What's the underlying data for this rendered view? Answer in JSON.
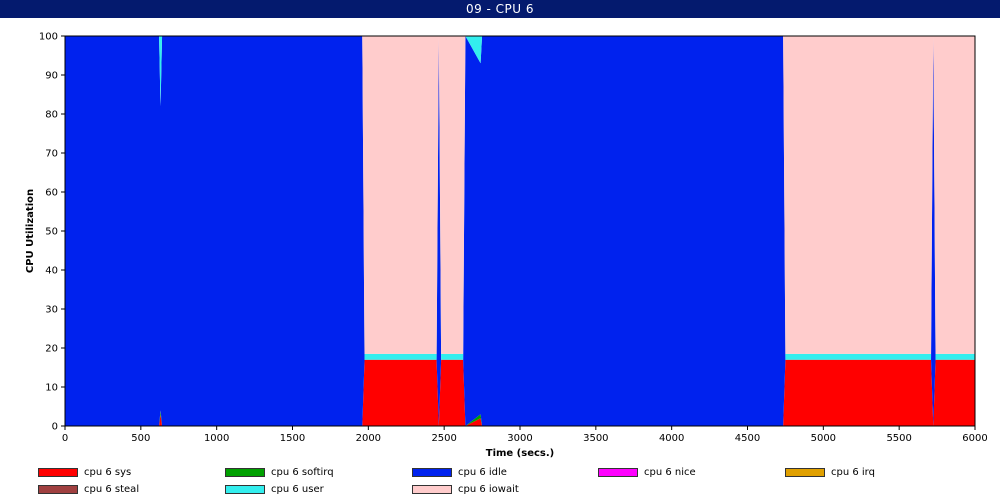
{
  "window": {
    "title": "09 - CPU 6"
  },
  "chart_data": {
    "type": "area",
    "stacked": true,
    "title": "09 - CPU 6",
    "xlabel": "Time (secs.)",
    "ylabel": "CPU Utilization",
    "xlim": [
      0,
      6000
    ],
    "ylim": [
      0,
      100
    ],
    "x_ticks": [
      0,
      500,
      1000,
      1500,
      2000,
      2500,
      3000,
      3500,
      4000,
      4500,
      5000,
      5500,
      6000
    ],
    "y_ticks": [
      0,
      10,
      20,
      30,
      40,
      50,
      60,
      70,
      80,
      90,
      100
    ],
    "grid": false,
    "legend_position": "bottom",
    "x": [
      0,
      620,
      630,
      640,
      650,
      1960,
      1975,
      1990,
      2450,
      2465,
      2480,
      2500,
      2625,
      2640,
      2740,
      2750,
      2760,
      4735,
      4750,
      4765,
      5710,
      5725,
      5740,
      5755,
      6000
    ],
    "series": [
      {
        "name": "cpu 6 sys",
        "color": "#ff0000",
        "values": [
          0,
          0,
          3,
          0,
          0,
          0,
          17,
          17,
          17,
          0,
          17,
          17,
          17,
          0,
          2,
          0,
          0,
          0,
          17,
          17,
          17,
          0,
          17,
          17,
          17
        ]
      },
      {
        "name": "cpu 6 softirq",
        "color": "#00a000",
        "values": [
          0,
          0,
          1,
          0,
          0,
          0,
          0,
          0,
          0,
          0,
          0,
          0,
          0,
          0,
          1,
          0,
          0,
          0,
          0,
          0,
          0,
          0,
          0,
          0,
          0
        ]
      },
      {
        "name": "cpu 6 idle",
        "color": "#0022ee",
        "values": [
          100,
          100,
          78,
          100,
          100,
          100,
          0,
          0,
          0,
          100,
          0,
          0,
          0,
          100,
          90,
          100,
          100,
          100,
          0,
          0,
          0,
          100,
          0,
          0,
          0
        ]
      },
      {
        "name": "cpu 6 nice",
        "color": "#ff00ff",
        "values": [
          0,
          0,
          0,
          0,
          0,
          0,
          0,
          0,
          0,
          0,
          0,
          0,
          0,
          0,
          0,
          0,
          0,
          0,
          0,
          0,
          0,
          0,
          0,
          0,
          0
        ]
      },
      {
        "name": "cpu 6 irq",
        "color": "#e0a000",
        "values": [
          0,
          0,
          0,
          0,
          0,
          0,
          0,
          0,
          0,
          0,
          0,
          0,
          0,
          0,
          0,
          0,
          0,
          0,
          0,
          0,
          0,
          0,
          0,
          0,
          0
        ]
      },
      {
        "name": "cpu 6 steal",
        "color": "#a04040",
        "values": [
          0,
          0,
          0,
          0,
          0,
          0,
          0,
          0,
          0,
          0,
          0,
          0,
          0,
          0,
          0,
          0,
          0,
          0,
          0,
          0,
          0,
          0,
          0,
          0,
          0
        ]
      },
      {
        "name": "cpu 6 user",
        "color": "#33eeee",
        "values": [
          0,
          0,
          18,
          0,
          0,
          0,
          1.5,
          1.5,
          1.5,
          0,
          1.5,
          1.5,
          1.5,
          0,
          7,
          0,
          0,
          0,
          1.5,
          1.5,
          1.5,
          0,
          1.5,
          1.5,
          1.5
        ]
      },
      {
        "name": "cpu 6 iowait",
        "color": "#ffcccc",
        "values": [
          0,
          0,
          0,
          0,
          0,
          0,
          81.5,
          81.5,
          81.5,
          0,
          81.5,
          81.5,
          81.5,
          0,
          0,
          0,
          0,
          0,
          81.5,
          81.5,
          81.5,
          0,
          81.5,
          81.5,
          81.5
        ]
      }
    ]
  }
}
